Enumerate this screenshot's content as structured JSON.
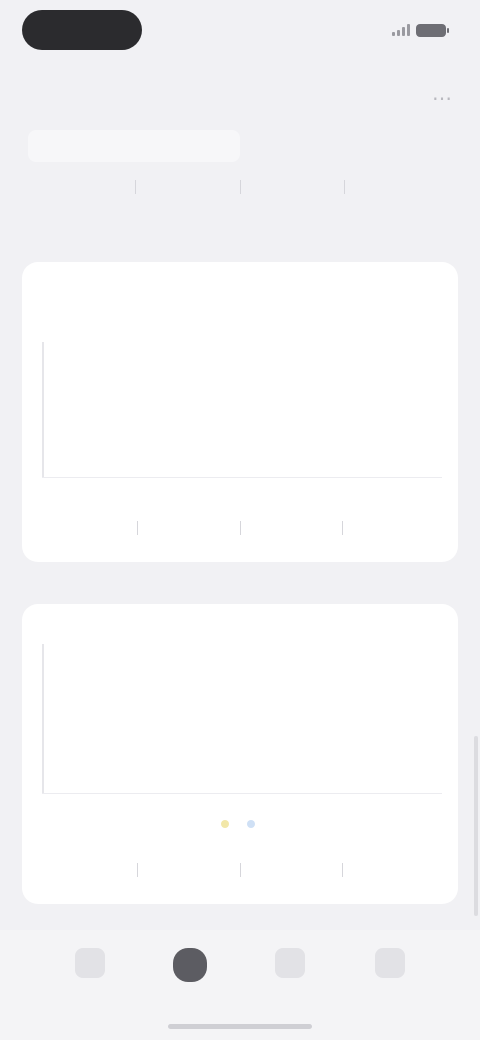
{
  "status_bar": {
    "time": "",
    "signal_icon": "signal-icon",
    "battery_icon": "battery-icon"
  },
  "nav": {
    "title": "",
    "action_icon": "more-icon"
  },
  "segments": [
    {
      "label": ""
    },
    {
      "label": ""
    }
  ],
  "periods": [
    {
      "label": ""
    },
    {
      "label": ""
    },
    {
      "label": ""
    },
    {
      "label": ""
    }
  ],
  "card_1": {
    "label": "",
    "value": "",
    "x_ticks": [
      "",
      "",
      "",
      "",
      "",
      ""
    ],
    "footer": [
      "",
      "",
      "",
      ""
    ]
  },
  "card_2": {
    "label": "",
    "x_ticks": [
      "",
      "",
      "",
      "",
      "",
      ""
    ],
    "legend": [
      {
        "label": "",
        "color": "#f2e7a8"
      },
      {
        "label": "",
        "color": "#cfe0f5"
      }
    ],
    "footer": [
      "",
      "",
      "",
      ""
    ]
  },
  "tab_bar": {
    "items": [
      {
        "label": "",
        "icon": "home-icon"
      },
      {
        "label": "",
        "icon": "chart-icon"
      },
      {
        "label": "",
        "icon": "list-icon"
      },
      {
        "label": "",
        "icon": "profile-icon"
      }
    ]
  }
}
